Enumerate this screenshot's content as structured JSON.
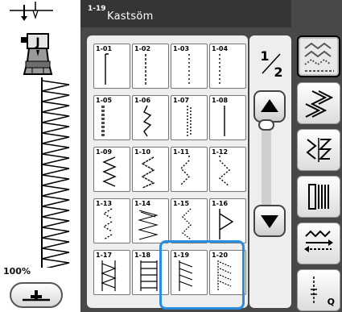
{
  "header": {
    "pattern_number": "1-19",
    "title": "Kastsöm"
  },
  "left_panel": {
    "zoom": "100%"
  },
  "pager": {
    "current_page": "1",
    "total_pages": "2"
  },
  "patterns": [
    {
      "id": "1-01"
    },
    {
      "id": "1-02"
    },
    {
      "id": "1-03"
    },
    {
      "id": "1-04"
    },
    {
      "id": "1-05"
    },
    {
      "id": "1-06"
    },
    {
      "id": "1-07"
    },
    {
      "id": "1-08"
    },
    {
      "id": "1-09"
    },
    {
      "id": "1-10"
    },
    {
      "id": "1-11"
    },
    {
      "id": "1-12"
    },
    {
      "id": "1-13"
    },
    {
      "id": "1-14"
    },
    {
      "id": "1-15"
    },
    {
      "id": "1-16"
    },
    {
      "id": "1-17"
    },
    {
      "id": "1-18"
    },
    {
      "id": "1-19"
    },
    {
      "id": "1-20"
    }
  ],
  "selected_pattern": "1-19",
  "categories": [
    {
      "name": "utility-stitches",
      "icon": "utility-stitch-icon",
      "active": true
    },
    {
      "name": "decorative-stitches",
      "icon": "decorative-stitch-icon",
      "active": false
    },
    {
      "name": "satin-stitches",
      "icon": "satin-stitch-icon",
      "active": false
    },
    {
      "name": "buttonhole",
      "icon": "buttonhole-icon",
      "active": false
    },
    {
      "name": "alignment",
      "icon": "stitch-alignment-icon",
      "active": false
    },
    {
      "name": "quilting",
      "icon": "quilting-icon",
      "active": false,
      "label": "Q"
    }
  ],
  "colors": {
    "selection": "#2a8de0",
    "panel": "#484848",
    "title_bar": "#353535"
  }
}
